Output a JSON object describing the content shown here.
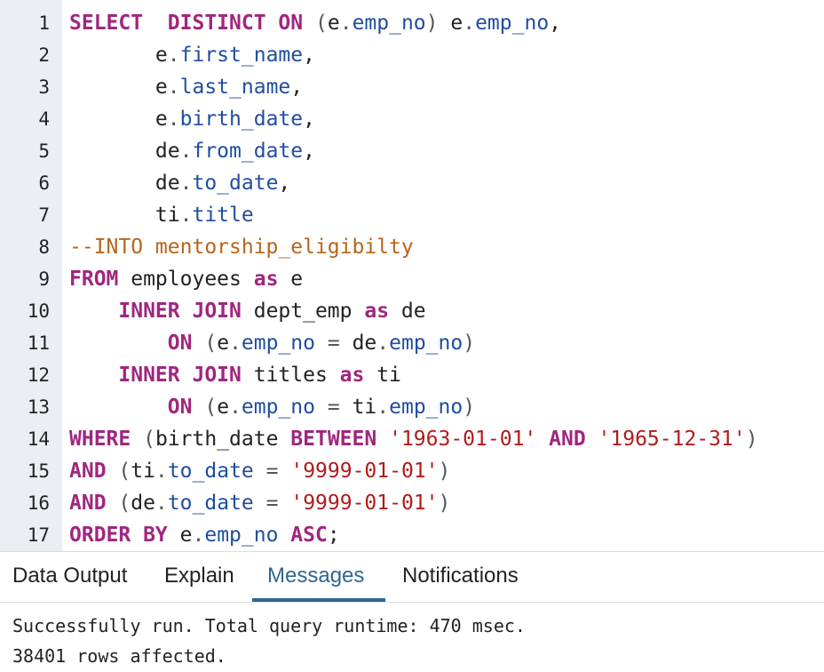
{
  "editor": {
    "line_numbers": [
      "1",
      "2",
      "3",
      "4",
      "5",
      "6",
      "7",
      "8",
      "9",
      "10",
      "11",
      "12",
      "13",
      "14",
      "15",
      "16",
      "17"
    ],
    "lines": [
      [
        {
          "t": "kw",
          "s": "SELECT"
        },
        {
          "t": "tx",
          "s": "  "
        },
        {
          "t": "kw",
          "s": "DISTINCT ON"
        },
        {
          "t": "tx",
          "s": " "
        },
        {
          "t": "pn",
          "s": "("
        },
        {
          "t": "tx",
          "s": "e"
        },
        {
          "t": "pn",
          "s": "."
        },
        {
          "t": "id",
          "s": "emp_no"
        },
        {
          "t": "pn",
          "s": ")"
        },
        {
          "t": "tx",
          "s": " e"
        },
        {
          "t": "pn",
          "s": "."
        },
        {
          "t": "id",
          "s": "emp_no"
        },
        {
          "t": "tx",
          "s": ","
        }
      ],
      [
        {
          "t": "tx",
          "s": "       e"
        },
        {
          "t": "pn",
          "s": "."
        },
        {
          "t": "id",
          "s": "first_name"
        },
        {
          "t": "tx",
          "s": ","
        }
      ],
      [
        {
          "t": "tx",
          "s": "       e"
        },
        {
          "t": "pn",
          "s": "."
        },
        {
          "t": "id",
          "s": "last_name"
        },
        {
          "t": "tx",
          "s": ","
        }
      ],
      [
        {
          "t": "tx",
          "s": "       e"
        },
        {
          "t": "pn",
          "s": "."
        },
        {
          "t": "id",
          "s": "birth_date"
        },
        {
          "t": "tx",
          "s": ","
        }
      ],
      [
        {
          "t": "tx",
          "s": "       de"
        },
        {
          "t": "pn",
          "s": "."
        },
        {
          "t": "id",
          "s": "from_date"
        },
        {
          "t": "tx",
          "s": ","
        }
      ],
      [
        {
          "t": "tx",
          "s": "       de"
        },
        {
          "t": "pn",
          "s": "."
        },
        {
          "t": "id",
          "s": "to_date"
        },
        {
          "t": "tx",
          "s": ","
        }
      ],
      [
        {
          "t": "tx",
          "s": "       ti"
        },
        {
          "t": "pn",
          "s": "."
        },
        {
          "t": "id",
          "s": "title"
        }
      ],
      [
        {
          "t": "cm",
          "s": "--INTO mentorship_eligibilty"
        }
      ],
      [
        {
          "t": "kw",
          "s": "FROM"
        },
        {
          "t": "tx",
          "s": " employees "
        },
        {
          "t": "kw",
          "s": "as"
        },
        {
          "t": "tx",
          "s": " e"
        }
      ],
      [
        {
          "t": "tx",
          "s": "    "
        },
        {
          "t": "kw",
          "s": "INNER JOIN"
        },
        {
          "t": "tx",
          "s": " dept_emp "
        },
        {
          "t": "kw",
          "s": "as"
        },
        {
          "t": "tx",
          "s": " de"
        }
      ],
      [
        {
          "t": "tx",
          "s": "        "
        },
        {
          "t": "kw",
          "s": "ON"
        },
        {
          "t": "tx",
          "s": " "
        },
        {
          "t": "pn",
          "s": "("
        },
        {
          "t": "tx",
          "s": "e"
        },
        {
          "t": "pn",
          "s": "."
        },
        {
          "t": "id",
          "s": "emp_no"
        },
        {
          "t": "tx",
          "s": " "
        },
        {
          "t": "pn",
          "s": "="
        },
        {
          "t": "tx",
          "s": " de"
        },
        {
          "t": "pn",
          "s": "."
        },
        {
          "t": "id",
          "s": "emp_no"
        },
        {
          "t": "pn",
          "s": ")"
        }
      ],
      [
        {
          "t": "tx",
          "s": "    "
        },
        {
          "t": "kw",
          "s": "INNER JOIN"
        },
        {
          "t": "tx",
          "s": " titles "
        },
        {
          "t": "kw",
          "s": "as"
        },
        {
          "t": "tx",
          "s": " ti"
        }
      ],
      [
        {
          "t": "tx",
          "s": "        "
        },
        {
          "t": "kw",
          "s": "ON"
        },
        {
          "t": "tx",
          "s": " "
        },
        {
          "t": "pn",
          "s": "("
        },
        {
          "t": "tx",
          "s": "e"
        },
        {
          "t": "pn",
          "s": "."
        },
        {
          "t": "id",
          "s": "emp_no"
        },
        {
          "t": "tx",
          "s": " "
        },
        {
          "t": "pn",
          "s": "="
        },
        {
          "t": "tx",
          "s": " ti"
        },
        {
          "t": "pn",
          "s": "."
        },
        {
          "t": "id",
          "s": "emp_no"
        },
        {
          "t": "pn",
          "s": ")"
        }
      ],
      [
        {
          "t": "kw",
          "s": "WHERE"
        },
        {
          "t": "tx",
          "s": " "
        },
        {
          "t": "pn",
          "s": "("
        },
        {
          "t": "tx",
          "s": "birth_date "
        },
        {
          "t": "kw",
          "s": "BETWEEN"
        },
        {
          "t": "tx",
          "s": " "
        },
        {
          "t": "str",
          "s": "'1963-01-01'"
        },
        {
          "t": "tx",
          "s": " "
        },
        {
          "t": "kw",
          "s": "AND"
        },
        {
          "t": "tx",
          "s": " "
        },
        {
          "t": "str",
          "s": "'1965-12-31'"
        },
        {
          "t": "pn",
          "s": ")"
        }
      ],
      [
        {
          "t": "kw",
          "s": "AND"
        },
        {
          "t": "tx",
          "s": " "
        },
        {
          "t": "pn",
          "s": "("
        },
        {
          "t": "tx",
          "s": "ti"
        },
        {
          "t": "pn",
          "s": "."
        },
        {
          "t": "id",
          "s": "to_date"
        },
        {
          "t": "tx",
          "s": " "
        },
        {
          "t": "pn",
          "s": "="
        },
        {
          "t": "tx",
          "s": " "
        },
        {
          "t": "str",
          "s": "'9999-01-01'"
        },
        {
          "t": "pn",
          "s": ")"
        }
      ],
      [
        {
          "t": "kw",
          "s": "AND"
        },
        {
          "t": "tx",
          "s": " "
        },
        {
          "t": "pn",
          "s": "("
        },
        {
          "t": "tx",
          "s": "de"
        },
        {
          "t": "pn",
          "s": "."
        },
        {
          "t": "id",
          "s": "to_date"
        },
        {
          "t": "tx",
          "s": " "
        },
        {
          "t": "pn",
          "s": "="
        },
        {
          "t": "tx",
          "s": " "
        },
        {
          "t": "str",
          "s": "'9999-01-01'"
        },
        {
          "t": "pn",
          "s": ")"
        }
      ],
      [
        {
          "t": "kw",
          "s": "ORDER BY"
        },
        {
          "t": "tx",
          "s": " e"
        },
        {
          "t": "pn",
          "s": "."
        },
        {
          "t": "id",
          "s": "emp_no"
        },
        {
          "t": "tx",
          "s": " "
        },
        {
          "t": "kw",
          "s": "ASC"
        },
        {
          "t": "tx",
          "s": ";"
        }
      ]
    ]
  },
  "tabs": {
    "data_output": "Data Output",
    "explain": "Explain",
    "messages": "Messages",
    "notifications": "Notifications",
    "active": "Messages"
  },
  "messages": {
    "line1": "Successfully run. Total query runtime: 470 msec.",
    "line2": "38401 rows affected."
  },
  "colors": {
    "keyword": "#a0267e",
    "identifier": "#1f4e9c",
    "string": "#b01c1c",
    "comment": "#b5651d",
    "active_tab": "#326690",
    "gutter": "#ebeef3"
  }
}
